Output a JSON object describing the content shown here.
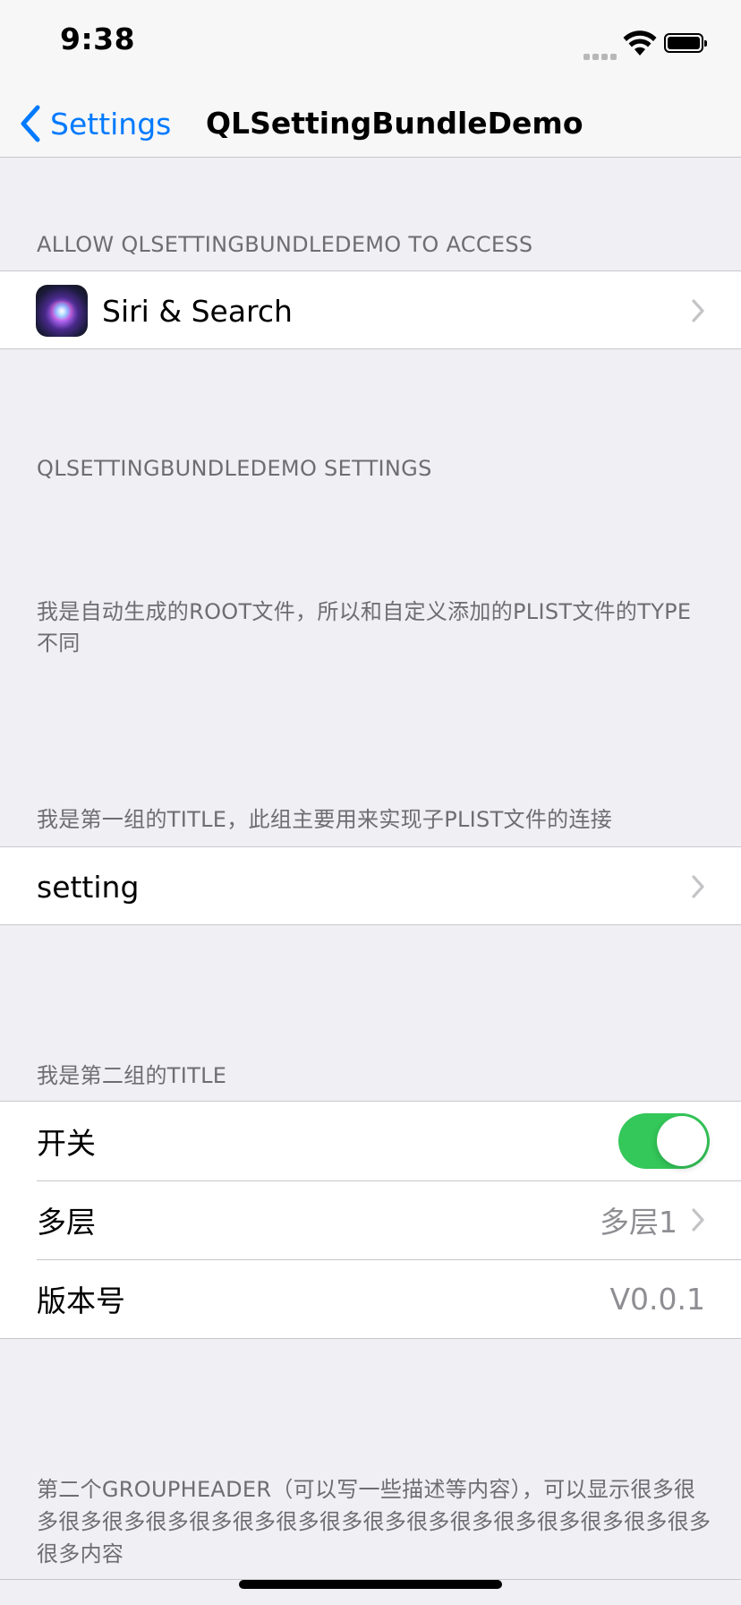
{
  "status_bar": {
    "time": "9:38"
  },
  "nav": {
    "back_label": "Settings",
    "title": "QLSettingBundleDemo"
  },
  "access_section": {
    "header": "ALLOW QLSETTINGBUNDLEDEMO TO ACCESS",
    "siri_row_label": "Siri & Search"
  },
  "settings_section": {
    "header": "QLSETTINGBUNDLEDEMO SETTINGS"
  },
  "root_note": {
    "text": "我是自动生成的ROOT文件，所以和自定义添加的PLIST文件的TYPE不同"
  },
  "group1": {
    "title": "我是第一组的TITLE，此组主要用来实现子PLIST文件的连接",
    "setting_row_label": "setting"
  },
  "group2": {
    "title": "我是第二组的TITLE",
    "toggle_row": {
      "label": "开关",
      "on": true
    },
    "multi_row": {
      "label": "多层",
      "value": "多层1"
    },
    "version_row": {
      "label": "版本号",
      "value": "V0.0.1"
    }
  },
  "footer": {
    "text": "第二个GROUPHEADER（可以写一些描述等内容），可以显示很多很多很多很多很多很多很多很多很多很多很多很多很多很多很多很多很多很多内容"
  },
  "colors": {
    "accent": "#007aff",
    "toggle_on": "#34c759",
    "background": "#efeff4",
    "secondary_text": "#6d6d72"
  },
  "icons": [
    "chevron-left-icon",
    "wifi-icon",
    "battery-icon",
    "siri-icon",
    "chevron-right-icon"
  ]
}
